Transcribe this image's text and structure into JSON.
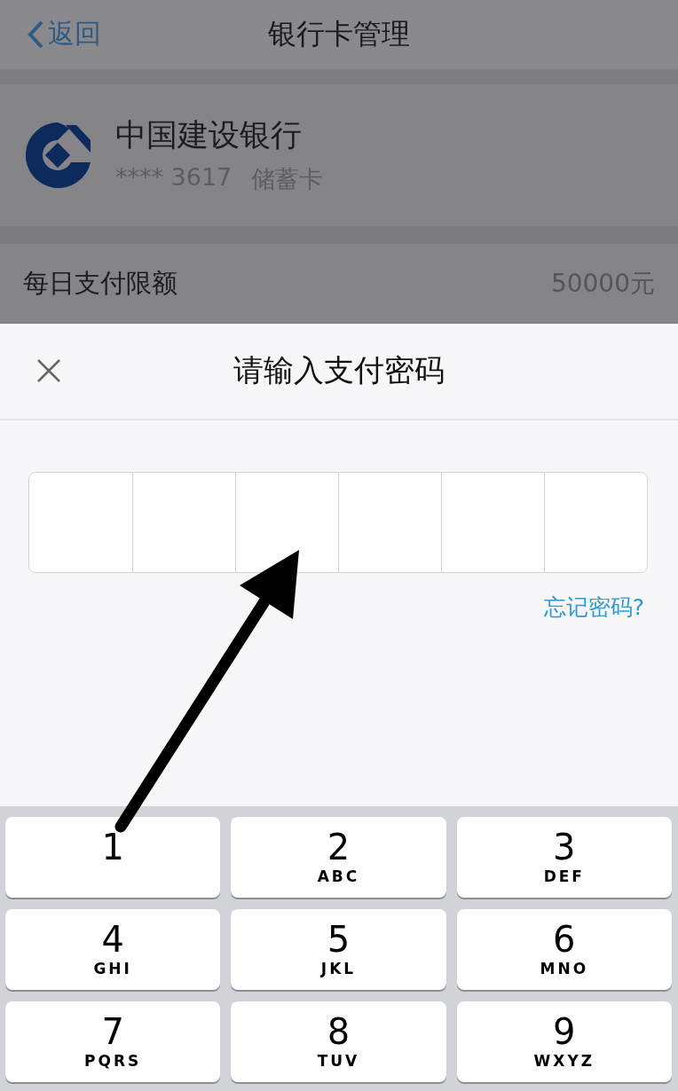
{
  "nav": {
    "back": "返回",
    "title": "银行卡管理"
  },
  "card": {
    "bank": "中国建设银行",
    "number": "**** 3617",
    "type": "储蓄卡"
  },
  "limit": {
    "label": "每日支付限额",
    "value": "50000元"
  },
  "sheet": {
    "title": "请输入支付密码",
    "forgot": "忘记密码?"
  },
  "keys": [
    {
      "digit": "1"
    },
    {
      "digit": "2",
      "letters": "ABC"
    },
    {
      "digit": "3",
      "letters": "DEF"
    },
    {
      "digit": "4",
      "letters": "GHI"
    },
    {
      "digit": "5",
      "letters": "JKL"
    },
    {
      "digit": "6",
      "letters": "MNO"
    },
    {
      "digit": "7",
      "letters": "PQRS"
    },
    {
      "digit": "8",
      "letters": "TUV"
    },
    {
      "digit": "9",
      "letters": "WXYZ"
    }
  ]
}
